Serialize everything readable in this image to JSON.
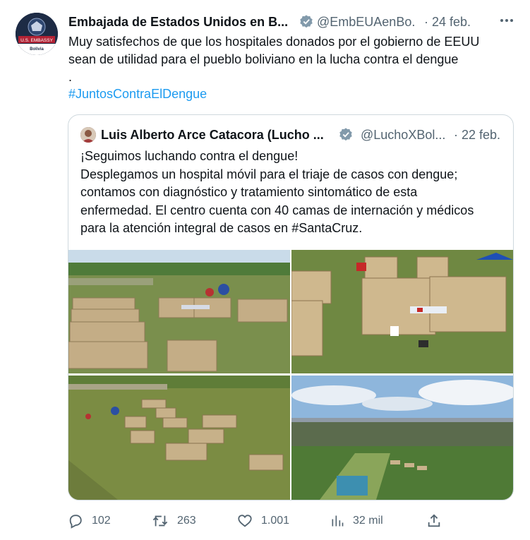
{
  "tweet": {
    "author_name": "Embajada de Estados Unidos en B...",
    "handle": "@EmbEUAenBo...",
    "time": "· 24 feb.",
    "avatar": {
      "line1": "U.S. EMBASSY",
      "line2": "Bolivia"
    },
    "text_line1": "Muy satisfechos de que los hospitales donados por el gobierno de EEUU",
    "text_line2": "sean de utilidad para el pueblo boliviano en la lucha contra el dengue",
    "text_line3": ".",
    "hashtag": "#JuntosContraElDengue"
  },
  "quote": {
    "author_name": "Luis Alberto Arce Catacora (Lucho ...",
    "handle": "@LuchoXBol...",
    "time": "· 22 feb.",
    "text_line1": "¡Seguimos luchando contra el dengue!",
    "text_line2": "Desplegamos un hospital móvil para el triaje de casos con dengue;",
    "text_line3": "contamos con diagnóstico y tratamiento sintomático de esta",
    "text_line4": "enfermedad. El centro cuenta con 40 camas de internación y médicos",
    "text_line5": "para la atención integral de casos en #SantaCruz.",
    "photos": [
      "photo-tent-camp-aerial",
      "photo-tents-closeup",
      "photo-field-tents-overhead",
      "photo-city-skyline"
    ]
  },
  "actions": {
    "replies": "102",
    "retweets": "263",
    "likes": "1.001",
    "views": "32 mil"
  },
  "colors": {
    "accent": "#1d9bf0",
    "muted": "#536471",
    "border": "#cfd9de",
    "verified": "#829aab"
  },
  "icons": [
    "more-icon",
    "verified-icon",
    "reply-icon",
    "retweet-icon",
    "like-icon",
    "views-icon",
    "share-icon"
  ]
}
